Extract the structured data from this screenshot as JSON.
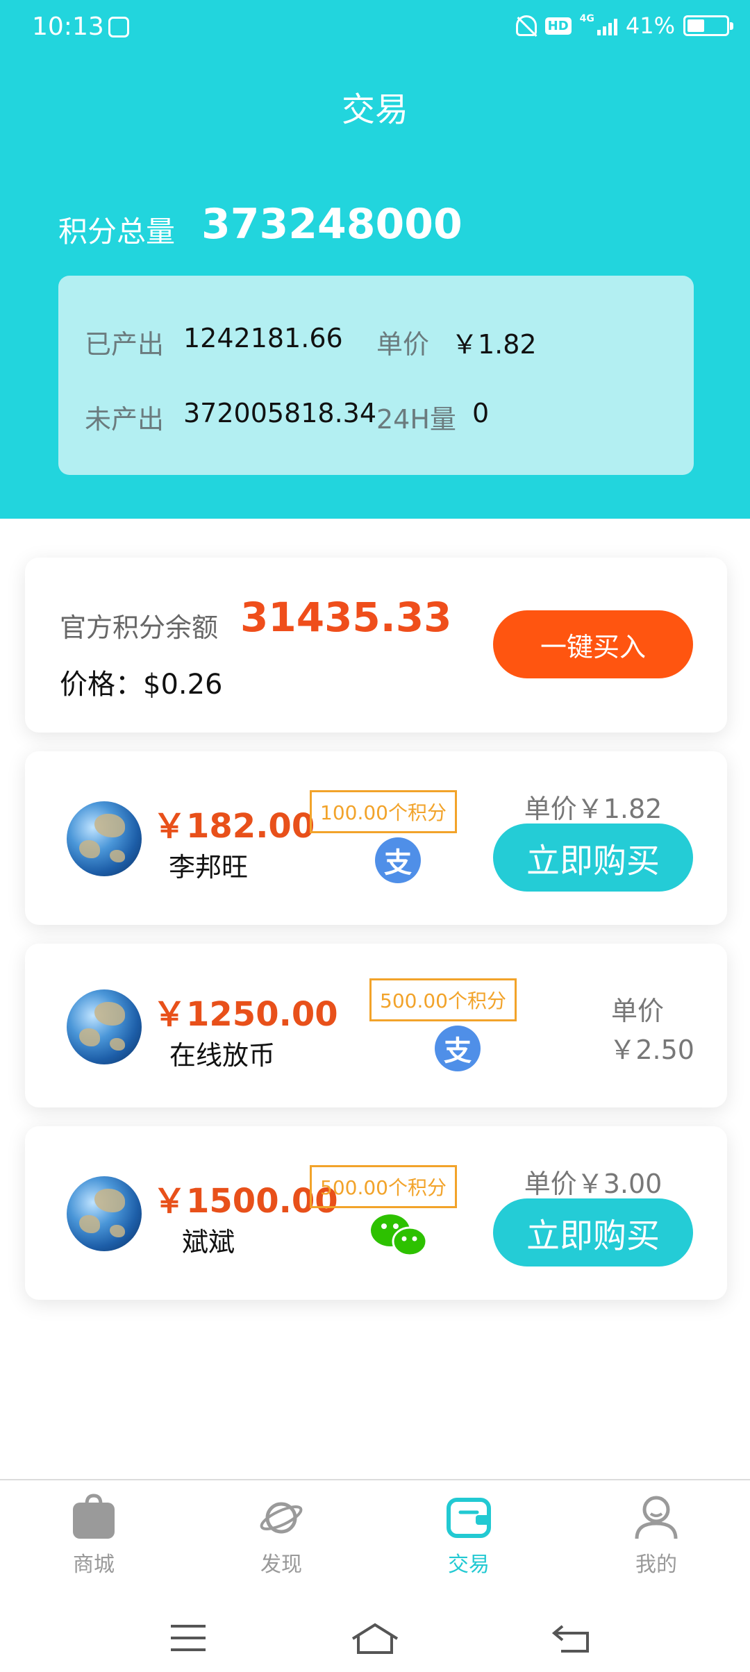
{
  "status_bar": {
    "time": "10:13",
    "network": "4G",
    "hd": "HD",
    "battery": "41%"
  },
  "title": "交易",
  "summary": {
    "total_label": "积分总量",
    "total_value": "373248000"
  },
  "stats": {
    "produced_label": "已产出",
    "produced_value": "1242181.66",
    "unit_price_label": "单价",
    "unit_price_value": "￥1.82",
    "unproduced_label": "未产出",
    "unproduced_value": "372005818.34",
    "volume_label": "24H量",
    "volume_value": "0"
  },
  "official": {
    "balance_label": "官方积分余额",
    "balance_value": "31435.33",
    "price_text": "价格：$0.26",
    "buy_all_label": "一键买入"
  },
  "listings": [
    {
      "amount": "￥182.00",
      "name": "李邦旺",
      "points": "100.00个积分",
      "payment": "alipay-icon",
      "unit_price": "单价￥1.82",
      "buy_label": "立即购买"
    },
    {
      "amount": "￥1250.00",
      "name": "在线放币",
      "points": "500.00个积分",
      "payment": "alipay-icon",
      "unit_price_label": "单价",
      "unit_price_value": "￥2.50"
    },
    {
      "amount": "￥1500.00",
      "name": "斌斌",
      "points": "500.00个积分",
      "payment": "wechat-icon",
      "unit_price": "单价￥3.00",
      "buy_label": "立即购买"
    }
  ],
  "alipay_glyph": "支",
  "tabs": [
    {
      "label": "商城",
      "icon": "bag-icon"
    },
    {
      "label": "发现",
      "icon": "planet-icon"
    },
    {
      "label": "交易",
      "icon": "wallet-icon",
      "active": true
    },
    {
      "label": "我的",
      "icon": "user-icon"
    }
  ],
  "colors": {
    "accent": "#22d5dd",
    "price": "#e8501a",
    "buy_all": "#ff5510",
    "tag": "#f2a32a"
  }
}
